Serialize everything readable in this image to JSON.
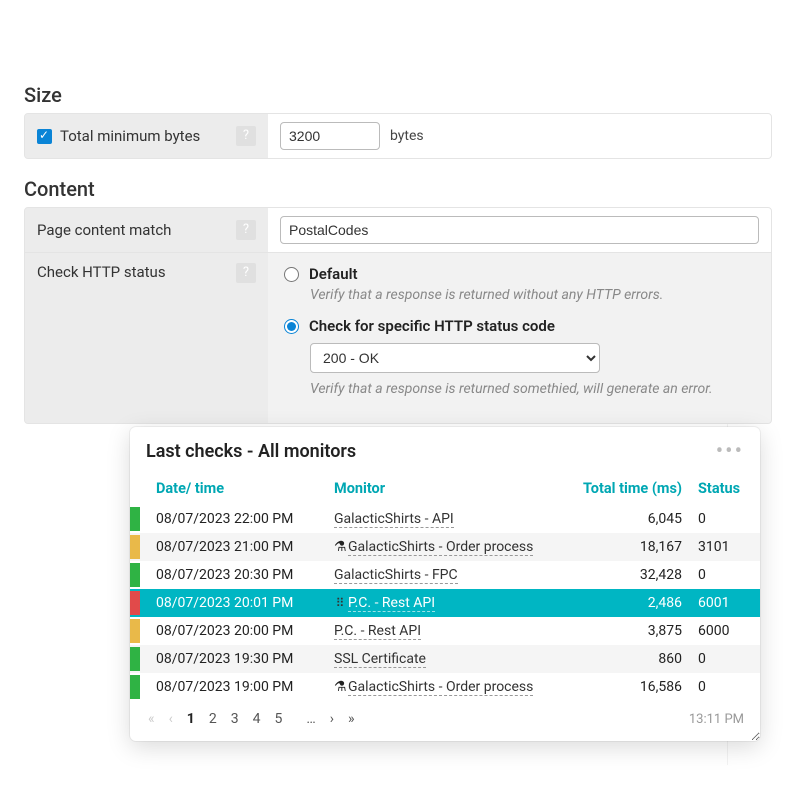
{
  "sections": {
    "size_title": "Size",
    "content_title": "Content"
  },
  "size": {
    "label": "Total minimum bytes",
    "value": "3200",
    "unit": "bytes"
  },
  "content": {
    "page_match_label": "Page content match",
    "page_match_value": "PostalCodes",
    "http_status_label": "Check HTTP status",
    "radio_default_label": "Default",
    "radio_default_desc": "Verify that a response is returned without any HTTP errors.",
    "radio_specific_label": "Check for specific HTTP status code",
    "status_select_value": "200 - OK",
    "radio_specific_desc": "Verify that a response is returned somethied, will generate an error."
  },
  "card": {
    "title": "Last checks - All monitors",
    "headers": {
      "datetime": "Date/ time",
      "monitor": "Monitor",
      "total_time": "Total time (ms)",
      "status": "Status"
    },
    "rows": [
      {
        "color": "green",
        "stripe": false,
        "hl": false,
        "datetime": "08/07/2023 22:00 PM",
        "icon": "",
        "monitor": "GalacticShirts - API",
        "time": "6,045",
        "status": "0"
      },
      {
        "color": "yellow",
        "stripe": true,
        "hl": false,
        "datetime": "08/07/2023 21:00 PM",
        "icon": "flask",
        "monitor": "GalacticShirts - Order process",
        "time": "18,167",
        "status": "3101"
      },
      {
        "color": "green",
        "stripe": false,
        "hl": false,
        "datetime": "08/07/2023 20:30 PM",
        "icon": "",
        "monitor": "GalacticShirts - FPC",
        "time": "32,428",
        "status": "0"
      },
      {
        "color": "red",
        "stripe": false,
        "hl": true,
        "datetime": "08/07/2023 20:01 PM",
        "icon": "drag",
        "monitor": "P.C. - Rest API",
        "time": "2,486",
        "status": "6001"
      },
      {
        "color": "yellow",
        "stripe": false,
        "hl": false,
        "datetime": "08/07/2023 20:00 PM",
        "icon": "",
        "monitor": "P.C. - Rest API",
        "time": "3,875",
        "status": "6000"
      },
      {
        "color": "green",
        "stripe": true,
        "hl": false,
        "datetime": "08/07/2023 19:30 PM",
        "icon": "",
        "monitor": "SSL Certificate",
        "time": "860",
        "status": "0"
      },
      {
        "color": "green",
        "stripe": false,
        "hl": false,
        "datetime": "08/07/2023 19:00 PM",
        "icon": "flask",
        "monitor": "GalacticShirts - Order process",
        "time": "16,586",
        "status": "0"
      }
    ],
    "pager": {
      "pages": [
        "1",
        "2",
        "3",
        "4",
        "5"
      ],
      "ellipsis": "…"
    },
    "footer_time": "13:11 PM"
  },
  "glyphs": {
    "help": "?",
    "first": "«",
    "prev": "‹",
    "next": "›",
    "last": "»",
    "flask": "⚗",
    "drag": "⠿",
    "dots": "•••"
  }
}
